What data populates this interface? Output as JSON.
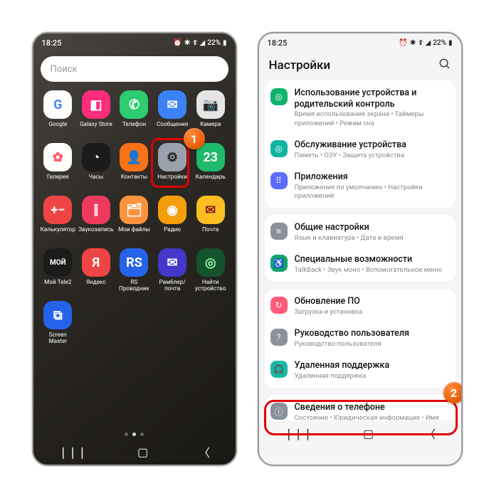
{
  "status": {
    "time": "18:25",
    "indicators_left": "⇆ ⫨",
    "indicators_right": "⏰ ✱ �países ◢ 22%",
    "battery": "22%"
  },
  "home": {
    "search_placeholder": "Поиск",
    "apps": [
      {
        "label": "Google",
        "bg": "#ffffff",
        "fg": "#4285F4",
        "glyph": "G"
      },
      {
        "label": "Galaxy Store",
        "bg": "#ff2d7a",
        "fg": "#fff",
        "glyph": "◧"
      },
      {
        "label": "Телефон",
        "bg": "#2ecc71",
        "fg": "#fff",
        "glyph": "✆"
      },
      {
        "label": "Сообщения",
        "bg": "#3b82f6",
        "fg": "#fff",
        "glyph": "✉"
      },
      {
        "label": "Камера",
        "bg": "#e5e5e5",
        "fg": "#222",
        "glyph": "📷"
      },
      {
        "label": "Галерея",
        "bg": "#ffffff",
        "fg": "#ff5a5f",
        "glyph": "✿"
      },
      {
        "label": "Часы",
        "bg": "#1b1b1b",
        "fg": "#eee",
        "glyph": "◔"
      },
      {
        "label": "Контакты",
        "bg": "#f97316",
        "fg": "#fff",
        "glyph": "👤"
      },
      {
        "label": "Настройки",
        "bg": "#9aa3ad",
        "fg": "#222",
        "glyph": "⚙"
      },
      {
        "label": "Календарь",
        "bg": "#1fb96b",
        "fg": "#fff",
        "glyph": "23"
      },
      {
        "label": "Калькулятор",
        "bg": "#ef4444",
        "fg": "#fff",
        "glyph": "+−"
      },
      {
        "label": "Звукозапись",
        "bg": "#ef3a5d",
        "fg": "#fff",
        "glyph": "⫿"
      },
      {
        "label": "Мои файлы",
        "bg": "#fb923c",
        "fg": "#fff",
        "glyph": "🗂"
      },
      {
        "label": "Радио",
        "bg": "#f59e0b",
        "fg": "#fff",
        "glyph": "◉"
      },
      {
        "label": "Почта",
        "bg": "#fbbf24",
        "fg": "#8b1a1a",
        "glyph": "✉"
      },
      {
        "label": "Мой Tele2",
        "bg": "#1b1b1b",
        "fg": "#fff",
        "glyph": "МОЙ"
      },
      {
        "label": "Яндекс",
        "bg": "#ef4444",
        "fg": "#fff",
        "glyph": "Я"
      },
      {
        "label": "RS Проводник",
        "bg": "#2563eb",
        "fg": "#fff",
        "glyph": "RS"
      },
      {
        "label": "Рамблер/ почта",
        "bg": "#4338ca",
        "fg": "#fff",
        "glyph": "✉"
      },
      {
        "label": "Найти устройство",
        "bg": "#14532d",
        "fg": "#8ef0a8",
        "glyph": "◎"
      },
      {
        "label": "Screen Master",
        "bg": "#2563eb",
        "fg": "#fff",
        "glyph": "⧉"
      }
    ],
    "badge1": "1"
  },
  "settings": {
    "title": "Настройки",
    "groups": [
      [
        {
          "icon_bg": "#0fb36b",
          "glyph": "◎",
          "title": "Использование устройства и родительский контроль",
          "sub": "Время использование экрана • Таймеры приложений • Режим сна"
        },
        {
          "icon_bg": "#0fb3a0",
          "glyph": "◎",
          "title": "Обслуживание устройства",
          "sub": "Память • ОЗУ • Защита устройства"
        },
        {
          "icon_bg": "#5b6cff",
          "glyph": "⠿",
          "title": "Приложения",
          "sub": "Приложения по умолчанию • Настройки приложений"
        }
      ],
      [
        {
          "icon_bg": "#8b9199",
          "glyph": "≡",
          "title": "Общие настройки",
          "sub": "Язык и клавиатура • Дата и время"
        },
        {
          "icon_bg": "#12a36b",
          "glyph": "♿",
          "title": "Специальные возможности",
          "sub": "TalkBack • Звук моно • Вспомогательное меню"
        }
      ],
      [
        {
          "icon_bg": "#ff5a7a",
          "glyph": "↻",
          "title": "Обновление ПО",
          "sub": "Загрузка и установка"
        },
        {
          "icon_bg": "#8b9199",
          "glyph": "?",
          "title": "Руководство пользователя",
          "sub": "Руководство пользователя"
        },
        {
          "icon_bg": "#14b8a6",
          "glyph": "🎧",
          "title": "Удаленная поддержка",
          "sub": "Удаленная поддержка"
        }
      ],
      [
        {
          "icon_bg": "#8b9199",
          "glyph": "ⓘ",
          "title": "Сведения о телефоне",
          "sub": "Состояние • Юридическая информация • Имя телефона"
        }
      ]
    ],
    "badge2": "2"
  }
}
